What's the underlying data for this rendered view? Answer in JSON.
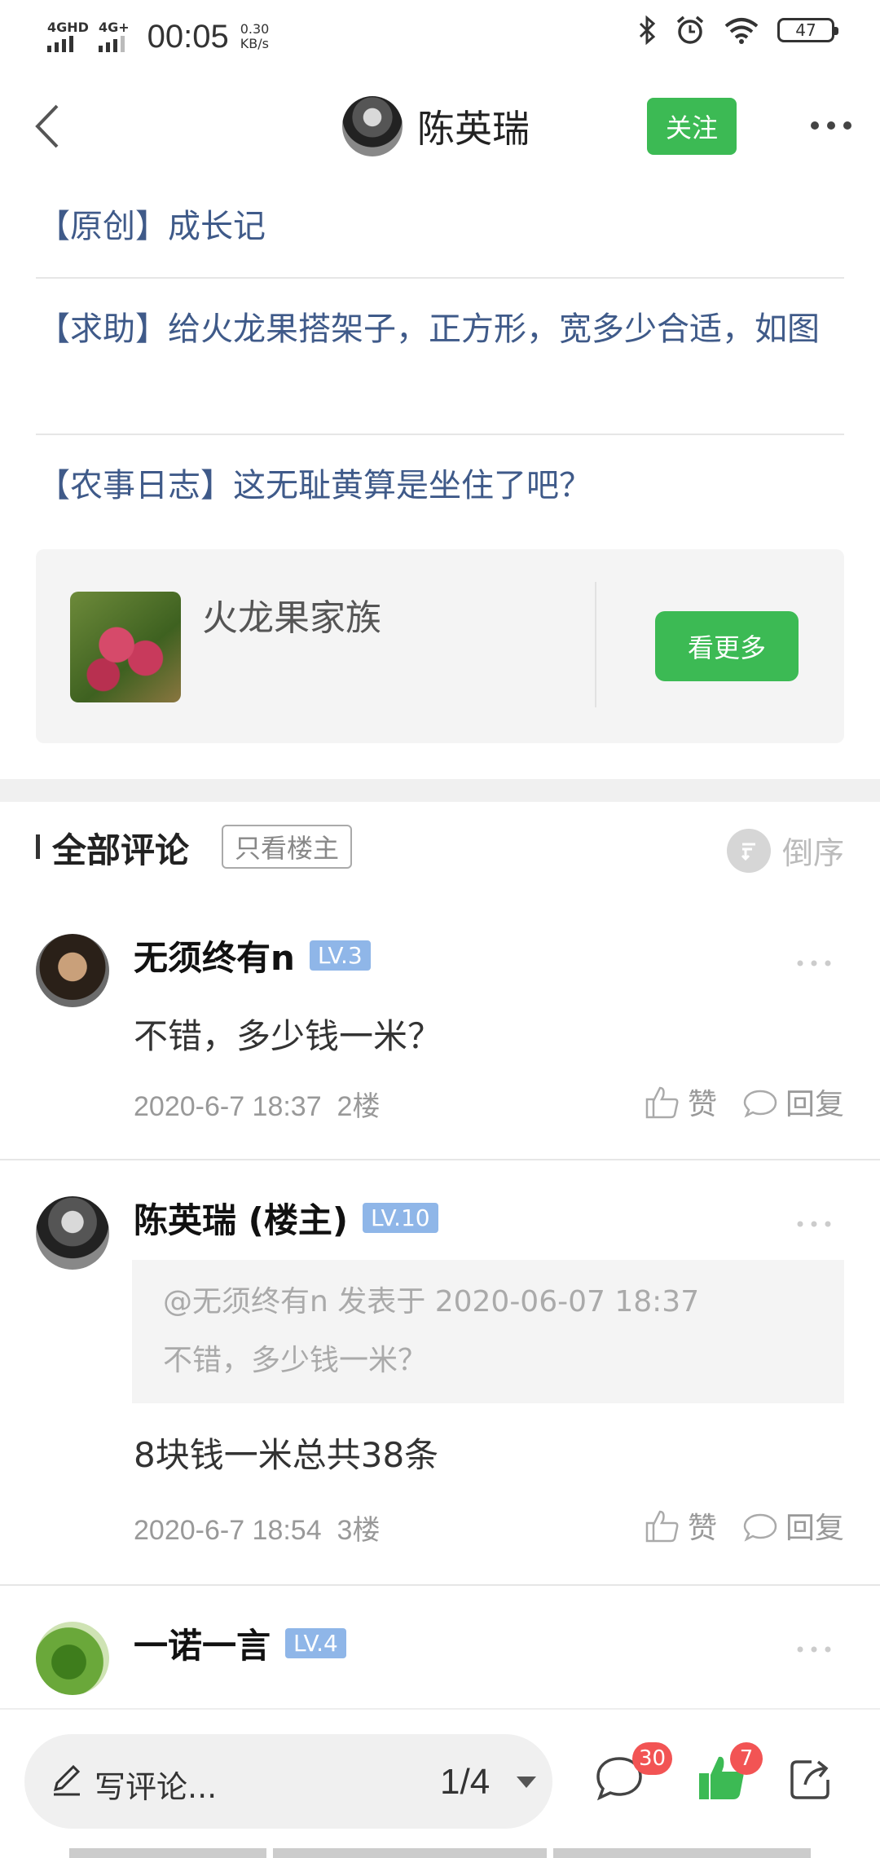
{
  "status_bar": {
    "signal1": "4GHD",
    "signal2": "4G+",
    "time": "00:05",
    "speed_value": "0.30",
    "speed_unit": "KB/s",
    "battery": "47"
  },
  "header": {
    "author_name": "陈英瑞",
    "follow_label": "关注"
  },
  "related_posts": [
    "【原创】成长记",
    "【求助】给火龙果搭架子，正方形，宽多少合适，如图",
    "【农事日志】这无耻黄算是坐住了吧？"
  ],
  "community": {
    "name": "火龙果家族",
    "see_more_label": "看更多"
  },
  "comments_section": {
    "title": "全部评论",
    "only_op_label": "只看楼主",
    "order_label": "倒序"
  },
  "comments": [
    {
      "name": "无须终有n",
      "level": "LV.3",
      "text": "不错，多少钱一米？",
      "time": "2020-6-7 18:37",
      "floor": "2楼",
      "like_label": "赞",
      "reply_label": "回复"
    },
    {
      "name": "陈英瑞 (楼主)",
      "level": "LV.10",
      "quote_head": "@无须终有n 发表于 2020-06-07 18:37",
      "quote_text": "不错，多少钱一米？",
      "text": "8块钱一米总共38条",
      "time": "2020-6-7 18:54",
      "floor": "3楼",
      "like_label": "赞",
      "reply_label": "回复"
    },
    {
      "name": "一诺一言",
      "level": "LV.4"
    }
  ],
  "bottom_bar": {
    "write_placeholder": "写评论...",
    "page_indicator": "1/4",
    "comment_count": "30",
    "like_count": "7"
  },
  "colors": {
    "accent_green": "#3cba54",
    "link_blue": "#3f5a89",
    "badge_red": "#f25454",
    "level_blue": "#8fb6e8"
  }
}
